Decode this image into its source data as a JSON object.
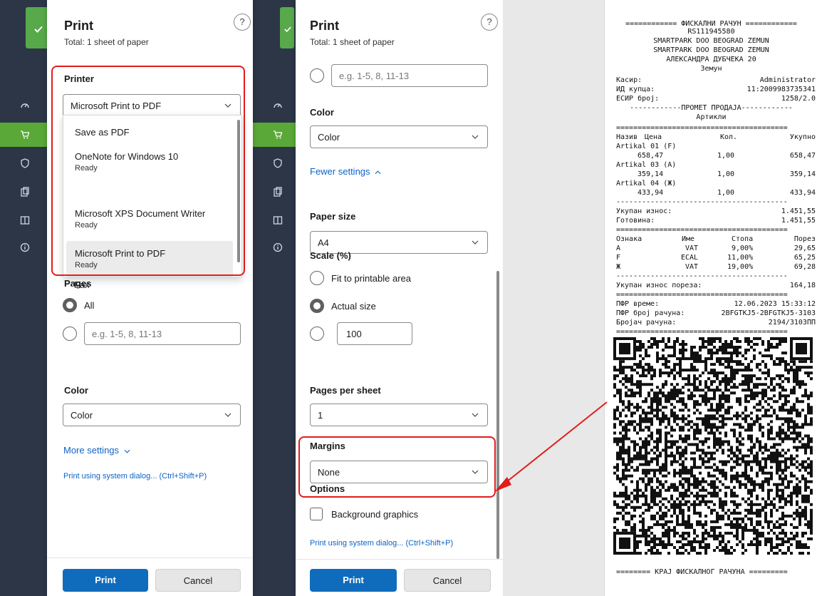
{
  "app_rail": {
    "icons": [
      "speed-icon",
      "cart-icon",
      "shield-icon",
      "clipboard-icon",
      "book-icon",
      "info-icon"
    ]
  },
  "left_panel": {
    "title": "Print",
    "subtitle": "Total: 1 sheet of paper",
    "help": "?",
    "printer_label": "Printer",
    "printer_value": "Microsoft Print to PDF",
    "printer_options": [
      {
        "name": "Save as PDF",
        "status": ""
      },
      {
        "name": "OneNote for Windows 10",
        "status": "Ready"
      },
      {
        "name": "Microsoft XPS Document Writer",
        "status": "Ready"
      },
      {
        "name": "Microsoft Print to PDF",
        "status": "Ready"
      },
      {
        "name": "Fax",
        "status": ""
      }
    ],
    "pages_label": "Pages",
    "pages_all": "All",
    "pages_placeholder": "e.g. 1-5, 8, 11-13",
    "color_label": "Color",
    "color_value": "Color",
    "more_settings": "More settings",
    "system_dialog": "Print using system dialog... (Ctrl+Shift+P)",
    "print_btn": "Print",
    "cancel_btn": "Cancel"
  },
  "right_panel": {
    "title": "Print",
    "subtitle": "Total: 1 sheet of paper",
    "help": "?",
    "pages_placeholder": "e.g. 1-5, 8, 11-13",
    "color_label": "Color",
    "color_value": "Color",
    "fewer_settings": "Fewer settings",
    "paper_size_label": "Paper size",
    "paper_size_value": "A4",
    "scale_label": "Scale (%)",
    "scale_fit": "Fit to printable area",
    "scale_actual": "Actual size",
    "scale_value": "100",
    "pages_per_sheet_label": "Pages per sheet",
    "pages_per_sheet_value": "1",
    "margins_label": "Margins",
    "margins_value": "None",
    "options_label": "Options",
    "background_graphics": "Background graphics",
    "system_dialog": "Print using system dialog... (Ctrl+Shift+P)",
    "print_btn": "Print",
    "cancel_btn": "Cancel"
  },
  "receipt": {
    "header": "============ ФИСКАЛНИ РАЧУН ============",
    "lines_center": [
      "RS111945580",
      "SMARTPARK DOO BEOGRAD ZEMUN",
      "SMARTPARK DOO BEOGRAD ZEMUN",
      "АЛЕКСАНДРА ДУБЧЕКА 20",
      "Земун"
    ],
    "cashier_label": "Касир:",
    "cashier_value": "Administrator",
    "buyer_label": "ИД купца:",
    "buyer_value": "11:2009983735341",
    "esir_label": "ЕСИР број:",
    "esir_value": "1258/2.0",
    "sale_header": "------------ПРОМЕТ ПРОДАЈА------------",
    "articles": "Артикли",
    "sep_eq": "========================================",
    "sep_dash": "----------------------------------------",
    "col_name": "Назив",
    "col_price": "Цена",
    "col_qty": "Кол.",
    "col_total": "Укупно",
    "items": [
      {
        "name": "Artikal 01 (F)",
        "price": "658,47",
        "qty": "1,00",
        "total": "658,47"
      },
      {
        "name": "Artikal 03 (A)",
        "price": "359,14",
        "qty": "1,00",
        "total": "359,14"
      },
      {
        "name": "Artikal 04 (Ж)",
        "price": "433,94",
        "qty": "1,00",
        "total": "433,94"
      }
    ],
    "total_label": "Укупан износ:",
    "total_value": "1.451,55",
    "cash_label": "Готовина:",
    "cash_value": "1.451,55",
    "tax_cols": [
      "Ознака",
      "Име",
      "Стопа",
      "Порез"
    ],
    "taxes": [
      {
        "code": "A",
        "name": "VAT",
        "rate": "9,00%",
        "tax": "29,65"
      },
      {
        "code": "F",
        "name": "ECAL",
        "rate": "11,00%",
        "tax": "65,25"
      },
      {
        "code": "Ж",
        "name": "VAT",
        "rate": "19,00%",
        "tax": "69,28"
      }
    ],
    "tax_total_label": "Укупан износ пореза:",
    "tax_total_value": "164,18",
    "pfr_time_label": "ПФР време:",
    "pfr_time_value": "12.06.2023 15:33:12",
    "pfr_number_label": "ПФР број рачуна:",
    "pfr_number_value": "2BFGTKJ5-2BFGTKJ5-3103",
    "counter_label": "Бројач рачуна:",
    "counter_value": "2194/3103ПП",
    "footer": "======== КРАЈ ФИСКАЛНОГ РАЧУНА ========="
  }
}
